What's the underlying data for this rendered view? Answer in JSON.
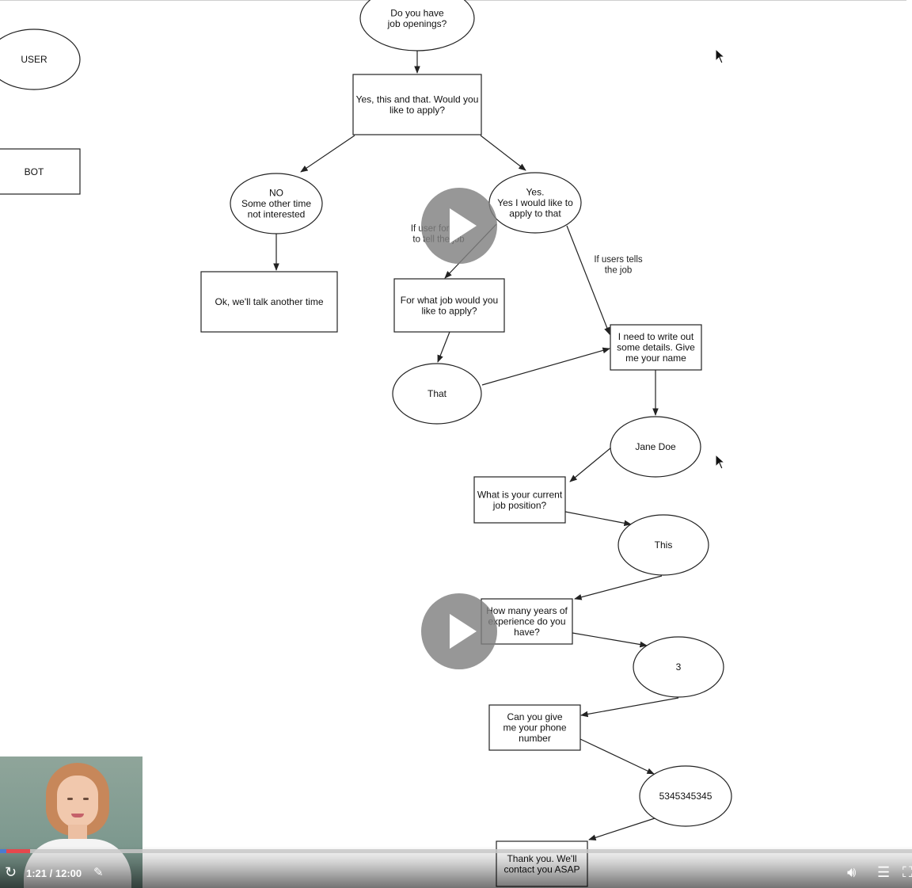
{
  "diagram": {
    "legend": {
      "user": "USER",
      "bot": "BOT"
    },
    "nodes": {
      "q_openings": [
        "Do you have",
        "job openings?"
      ],
      "a_yes_apply": [
        "Yes, this and that. Would you",
        "like to apply?"
      ],
      "no_answer": [
        "NO",
        "Some other time",
        "not interested"
      ],
      "yes_answer": [
        "Yes.",
        "Yes I would like to",
        "apply to that"
      ],
      "talk_later": [
        "Ok, we'll talk another time"
      ],
      "what_job": [
        "For what job would you",
        "like to apply?"
      ],
      "need_details": [
        "I need to write out",
        "some details. Give",
        "me your name"
      ],
      "that": [
        "That"
      ],
      "jane_doe": [
        "Jane Doe"
      ],
      "current_position": [
        "What is your current",
        "job position?"
      ],
      "this": [
        "This"
      ],
      "years_experience": [
        "How many years of",
        "experience do you",
        "have?"
      ],
      "three": [
        "3"
      ],
      "phone_q": [
        "Can you give",
        "me your phone",
        "number"
      ],
      "phone_number": [
        "5345345345"
      ],
      "thank_you": [
        "Thank you. We'll",
        "contact you ASAP"
      ]
    },
    "edge_labels": {
      "forgets_job": [
        "If user forgets",
        "to tell the job"
      ],
      "tells_job": [
        "If users tells",
        "the job"
      ]
    }
  },
  "player": {
    "time": "1:21 / 12:00",
    "progress_fraction": 0.0333,
    "icons": {
      "replay": "replay-icon",
      "notes": "notes-icon",
      "volume": "volume-icon",
      "transcript": "transcript-icon",
      "fullscreen": "fullscreen-icon",
      "play": "play-icon"
    },
    "accent": "#e5484d"
  }
}
